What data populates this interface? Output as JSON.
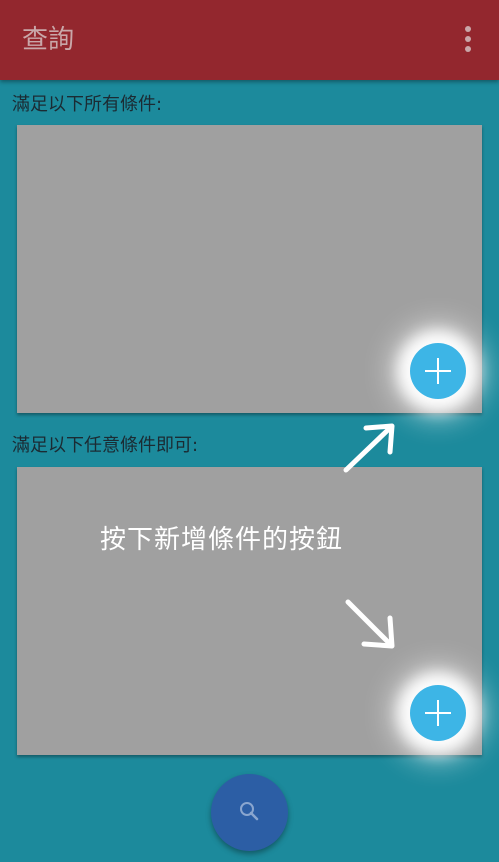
{
  "appbar": {
    "title": "查詢",
    "overflow_icon": "more-vert-icon"
  },
  "sections": [
    {
      "label": "滿足以下所有條件:",
      "add_icon": "plus-icon"
    },
    {
      "label": "滿足以下任意條件即可:",
      "add_icon": "plus-icon"
    }
  ],
  "hint": {
    "text": "按下新增條件的按鈕"
  },
  "search": {
    "icon": "search-icon"
  },
  "colors": {
    "appbar": "#93272e",
    "background": "#1c8a9c",
    "card": "#a0a0a0",
    "fab": "#3db5e6",
    "search_fab": "#2c5ea5"
  }
}
